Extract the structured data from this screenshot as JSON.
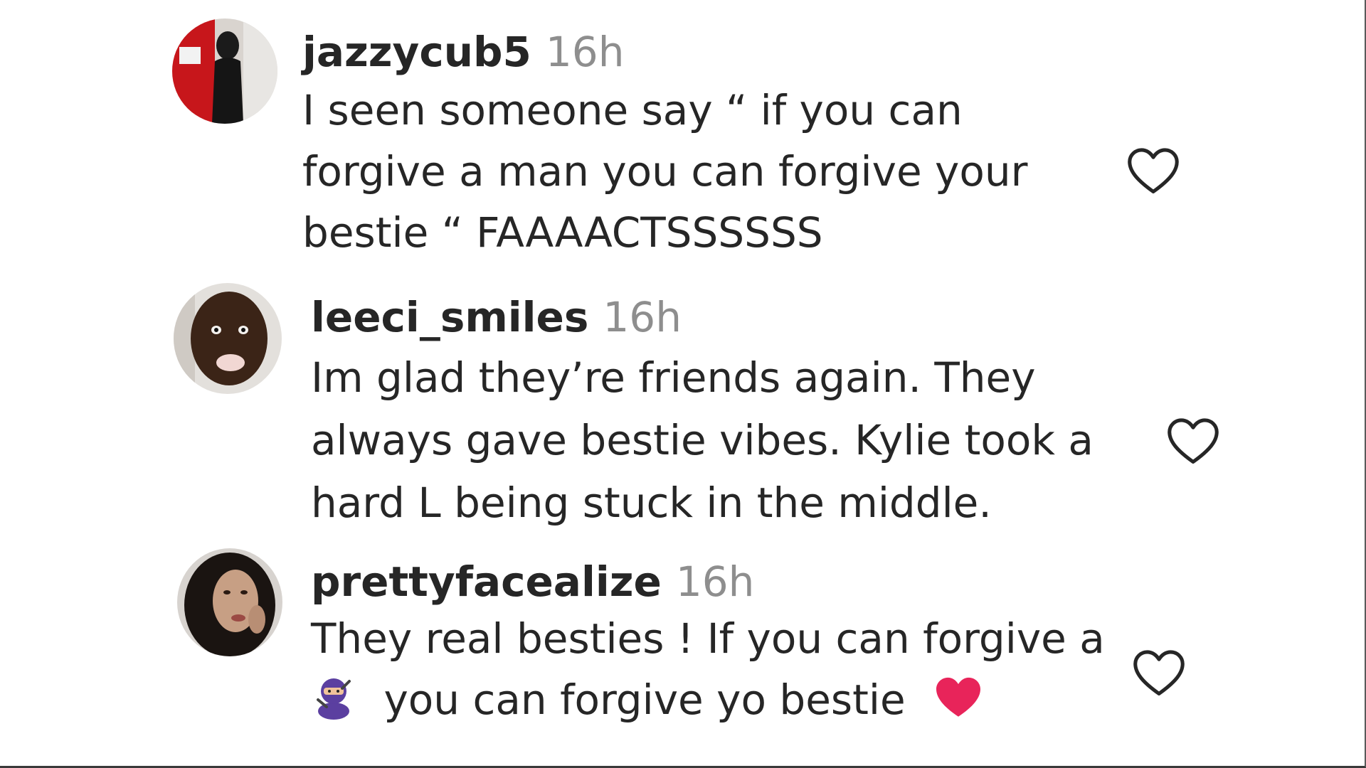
{
  "comments": [
    {
      "username": "jazzycub5",
      "time": "16h",
      "lines": [
        "I seen someone say “ if you can",
        "forgive a man you can forgive your",
        "bestie “ FAAAACTSSSSSS"
      ]
    },
    {
      "username": "leeci_smiles",
      "time": "16h",
      "lines": [
        "Im glad they’re friends again. They",
        "always gave bestie vibes. Kylie took a",
        "hard L being stuck in the middle."
      ]
    },
    {
      "username": "prettyfacealize",
      "time": "16h",
      "line1": "They real besties ! If you can forgive a",
      "line2_text": "you can forgive yo bestie"
    }
  ],
  "icons": {
    "like": "heart-outline-icon",
    "ninja": "ninja-emoji",
    "red_heart": "red-heart-emoji"
  },
  "colors": {
    "text": "#262626",
    "muted": "#8e8e8e",
    "heart_outline": "#262626",
    "red_heart": "#e8245a"
  }
}
